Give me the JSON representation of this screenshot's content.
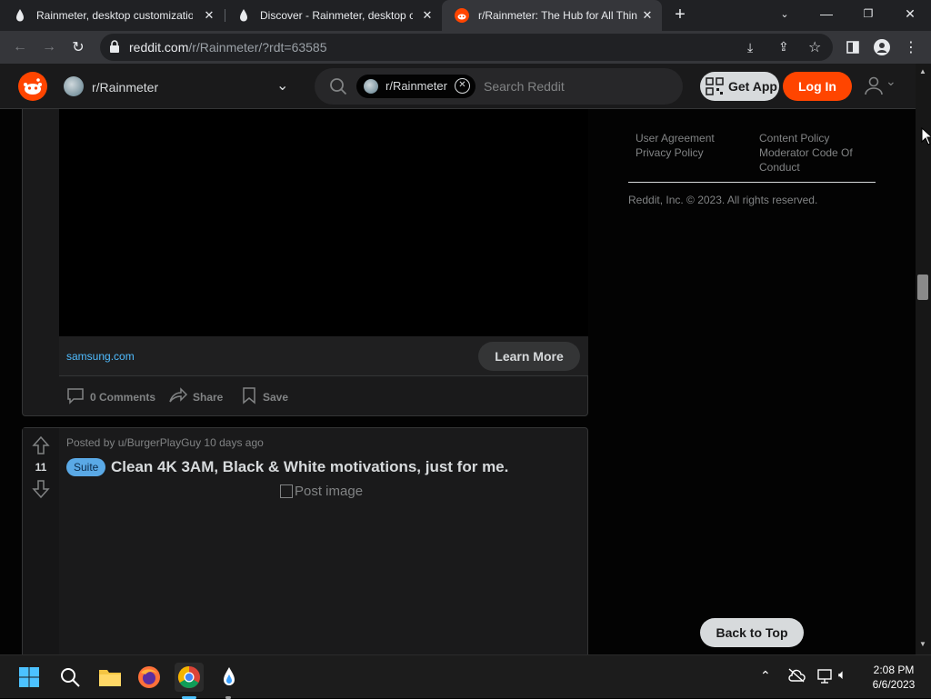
{
  "browser": {
    "tabs": [
      {
        "title": "Rainmeter, desktop customizatio",
        "active": false
      },
      {
        "title": "Discover - Rainmeter, desktop cu",
        "active": false
      },
      {
        "title": "r/Rainmeter: The Hub for All Thin",
        "active": true
      }
    ],
    "new_tab_label": "+",
    "url_domain": "reddit.com",
    "url_path": "/r/Rainmeter/?rdt=63585"
  },
  "reddit_header": {
    "community": "r/Rainmeter",
    "search_chip": "r/Rainmeter",
    "search_placeholder": "Search Reddit",
    "get_app_label": "Get App",
    "login_label": "Log In"
  },
  "ad_post": {
    "domain": "samsung.com",
    "cta_label": "Learn More",
    "comments_label": "0 Comments",
    "share_label": "Share",
    "save_label": "Save"
  },
  "post": {
    "byline": "Posted by u/BurgerPlayGuy 10 days ago",
    "votes": "11",
    "flair": "Suite",
    "title": "Clean 4K 3AM, Black & White motivations, just for me.",
    "image_alt": "Post image"
  },
  "sidebar_footer": {
    "links_col1": [
      "User Agreement",
      "Privacy Policy"
    ],
    "links_col2": [
      "Content Policy",
      "Moderator Code Of",
      "Conduct"
    ],
    "copyright": "Reddit, Inc. © 2023. All rights reserved.",
    "back_to_top_label": "Back to Top"
  },
  "taskbar": {
    "time": "2:08 PM",
    "date": "6/6/2023"
  },
  "colors": {
    "reddit_orange": "#ff4500",
    "flair_blue": "#0079d3",
    "link_blue": "#4fbcff"
  }
}
